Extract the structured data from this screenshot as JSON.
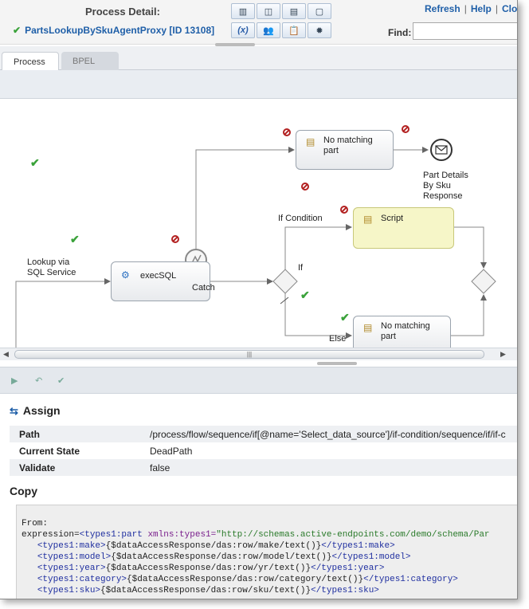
{
  "header": {
    "title": "Process Detail:",
    "process_name": "PartsLookupBySkuAgentProxy [ID 13108]",
    "links": [
      "Refresh",
      "Help",
      "Clos"
    ],
    "find_label": "Find:",
    "find_value": ""
  },
  "tabs": [
    {
      "label": "Process",
      "active": true
    },
    {
      "label": "BPEL",
      "active": false
    }
  ],
  "diagram": {
    "nodes": {
      "exec_sql": "execSQL",
      "no_match_top_1": "No matching",
      "no_match_top_2": "part",
      "script": "Script",
      "no_match_bot_1": "No matching",
      "no_match_bot_2": "part"
    },
    "labels": {
      "lookup_1": "Lookup via",
      "lookup_2": "SQL Service",
      "catch": "Catch",
      "if_condition": "If Condition",
      "if": "If",
      "else": "Else",
      "resp_1": "Part Details",
      "resp_2": "By Sku",
      "resp_3": "Response"
    }
  },
  "details": {
    "title": "Assign",
    "properties": [
      {
        "key": "Path",
        "value": "/process/flow/sequence/if[@name='Select_data_source']/if-condition/sequence/if/if-c"
      },
      {
        "key": "Current State",
        "value": "DeadPath"
      },
      {
        "key": "Validate",
        "value": "false"
      }
    ],
    "copy_title": "Copy",
    "code": {
      "from": "From:",
      "expr_prefix": "expression=",
      "expr_tag": "<types1:part",
      "expr_attr": " xmlns:types1=",
      "expr_str": "\"http://schemas.active-endpoints.com/demo/schema/Par",
      "lines": [
        {
          "open": "<types1:make>",
          "body": "{$dataAccessResponse/das:row/make/text()}",
          "close": "</types1:make>"
        },
        {
          "open": "<types1:model>",
          "body": "{$dataAccessResponse/das:row/model/text()}",
          "close": "</types1:model>"
        },
        {
          "open": "<types1:year>",
          "body": "{$dataAccessResponse/das:row/yr/text()}",
          "close": "</types1:year>"
        },
        {
          "open": "<types1:category>",
          "body": "{$dataAccessResponse/das:row/category/text()}",
          "close": "</types1:category>"
        },
        {
          "open": "<types1:sku>",
          "body": "{$dataAccessResponse/das:row/sku/text()}",
          "close": "</types1:sku>"
        }
      ]
    }
  },
  "colors": {
    "link": "#1f5fa8",
    "ok": "#3aa23a",
    "dead": "#b32222",
    "script_fill": "#f6f6c8"
  }
}
